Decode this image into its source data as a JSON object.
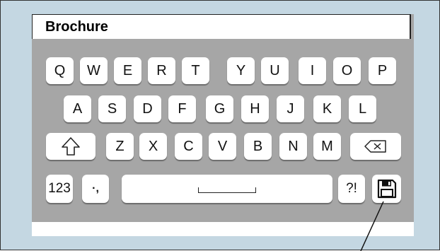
{
  "name_field": {
    "value": "Brochure"
  },
  "keyboard": {
    "row1": [
      "Q",
      "W",
      "E",
      "R",
      "T",
      "Y",
      "U",
      "I",
      "O",
      "P"
    ],
    "row2": [
      "A",
      "S",
      "D",
      "F",
      "G",
      "H",
      "J",
      "K",
      "L"
    ],
    "row3": [
      "Z",
      "X",
      "C",
      "V",
      "B",
      "N",
      "M"
    ],
    "row4": {
      "numeric": "123",
      "punct": "·,",
      "symbols": "?!"
    }
  },
  "icons": {
    "shift": "shift-arrow-icon",
    "backspace": "backspace-icon",
    "space": "space-bracket-icon",
    "save": "floppy-disk-icon"
  },
  "colors": {
    "outer_background": "#c4d7e2",
    "keyboard_background": "#a6a6a6",
    "key": "#ffffff"
  }
}
